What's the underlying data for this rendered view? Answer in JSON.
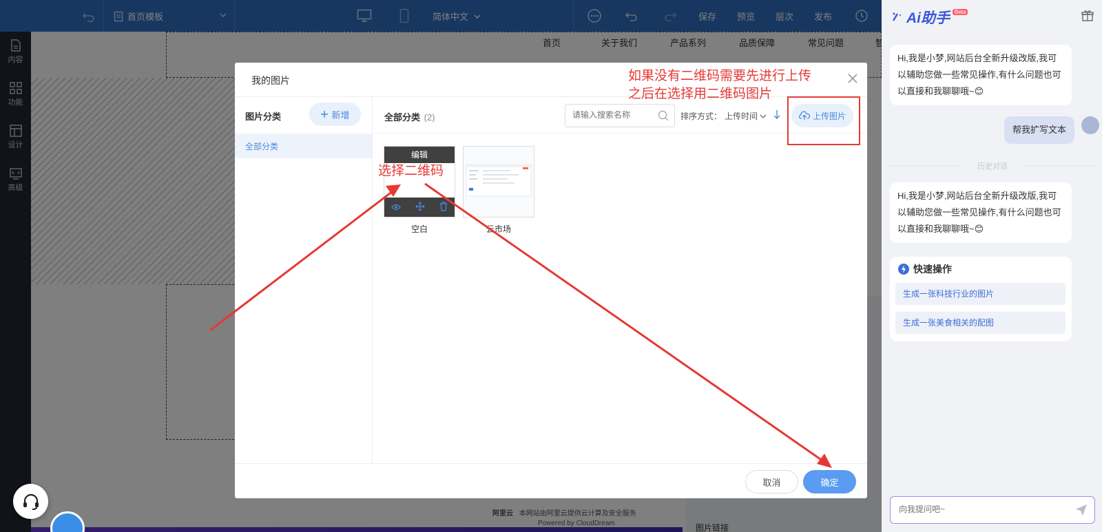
{
  "topbar": {
    "page_template": "首页模板",
    "language": "简体中文",
    "save": "保存",
    "preview": "预览",
    "layers": "层次",
    "publish": "发布"
  },
  "leftbar": {
    "items": [
      {
        "label": "内容",
        "icon": "file-icon"
      },
      {
        "label": "功能",
        "icon": "grid-icon"
      },
      {
        "label": "设计",
        "icon": "layout-icon"
      },
      {
        "label": "高级",
        "icon": "code-icon"
      }
    ]
  },
  "site_nav": [
    "首页",
    "关于我们",
    "产品系列",
    "品质保障",
    "常见问题",
    "智"
  ],
  "footer": {
    "brand": "阿里云",
    "line1": "本网站由阿里云提供云计算及安全服务",
    "line2": "Powered by CloudDream"
  },
  "right_panel_label": "图片链接",
  "modal": {
    "title": "我的图片",
    "category_header": "图片分类",
    "add_button": "新增",
    "category_items": [
      "全部分类"
    ],
    "all_category": "全部分类",
    "count": "(2)",
    "search_placeholder": "请输入搜索名称",
    "sort_label": "排序方式：",
    "sort_value": "上传时间",
    "upload_button": "上传图片",
    "images": [
      {
        "name": "空白",
        "hover_action": "编辑"
      },
      {
        "name": "云市场"
      }
    ],
    "cancel": "取消",
    "ok": "确定"
  },
  "annotations": {
    "upload_hint_line1": "如果没有二维码需要先进行上传",
    "upload_hint_line2": "之后在选择用二维码图片",
    "select_hint": "选择二维码",
    "color": "#e53935"
  },
  "ai": {
    "logo": "Ai助手",
    "beta": "Beta",
    "greeting": "Hi,我是小梦,网站后台全新升级改版,我可以辅助您做一些常见操作,有什么问题也可以直接和我聊聊哦~😊",
    "user_msg": "帮我扩写文本",
    "history_label": "历史对话",
    "greeting2": "Hi,我是小梦,网站后台全新升级改版,我可以辅助您做一些常见操作,有什么问题也可以直接和我聊聊哦~😊",
    "quick_title": "快速操作",
    "quick_items": [
      "生成一张科技行业的图片",
      "生成一张美食相关的配图"
    ],
    "input_placeholder": "向我提问吧~"
  }
}
